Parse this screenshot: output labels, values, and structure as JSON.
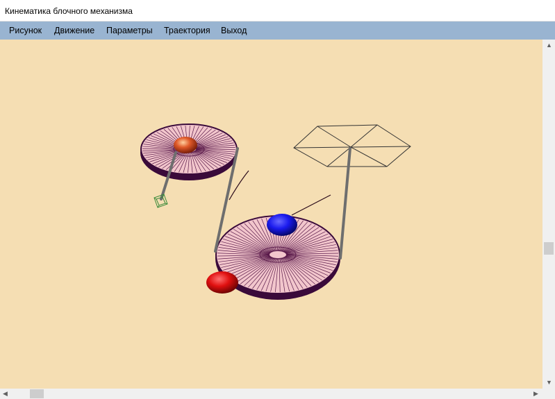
{
  "window": {
    "title": "Кинематика блочного механизма"
  },
  "menu": [
    {
      "id": "risunok",
      "label": "Рисунок"
    },
    {
      "id": "dvizhenie",
      "label": "Движение"
    },
    {
      "id": "parametry",
      "label": "Параметры"
    },
    {
      "id": "traektoriya",
      "label": "Траектория"
    },
    {
      "id": "vyhod",
      "label": "Выход"
    }
  ],
  "colors": {
    "canvas_bg": "#f5deb3",
    "menubar_bg": "#99b4d1",
    "pulley_fill": "#f2c6cc",
    "pulley_rim": "#3a0a3a",
    "spokes": "#5a1a4a",
    "rope": "#6e6e6e",
    "ball_orange": "#e05a2a",
    "ball_blue": "#1a1aee",
    "ball_red": "#e01010",
    "hanging_box": "#3a8a3a"
  },
  "icons": {
    "scroll_up": "chevron-up-icon",
    "scroll_down": "chevron-down-icon",
    "scroll_left": "chevron-left-icon",
    "scroll_right": "chevron-right-icon"
  }
}
